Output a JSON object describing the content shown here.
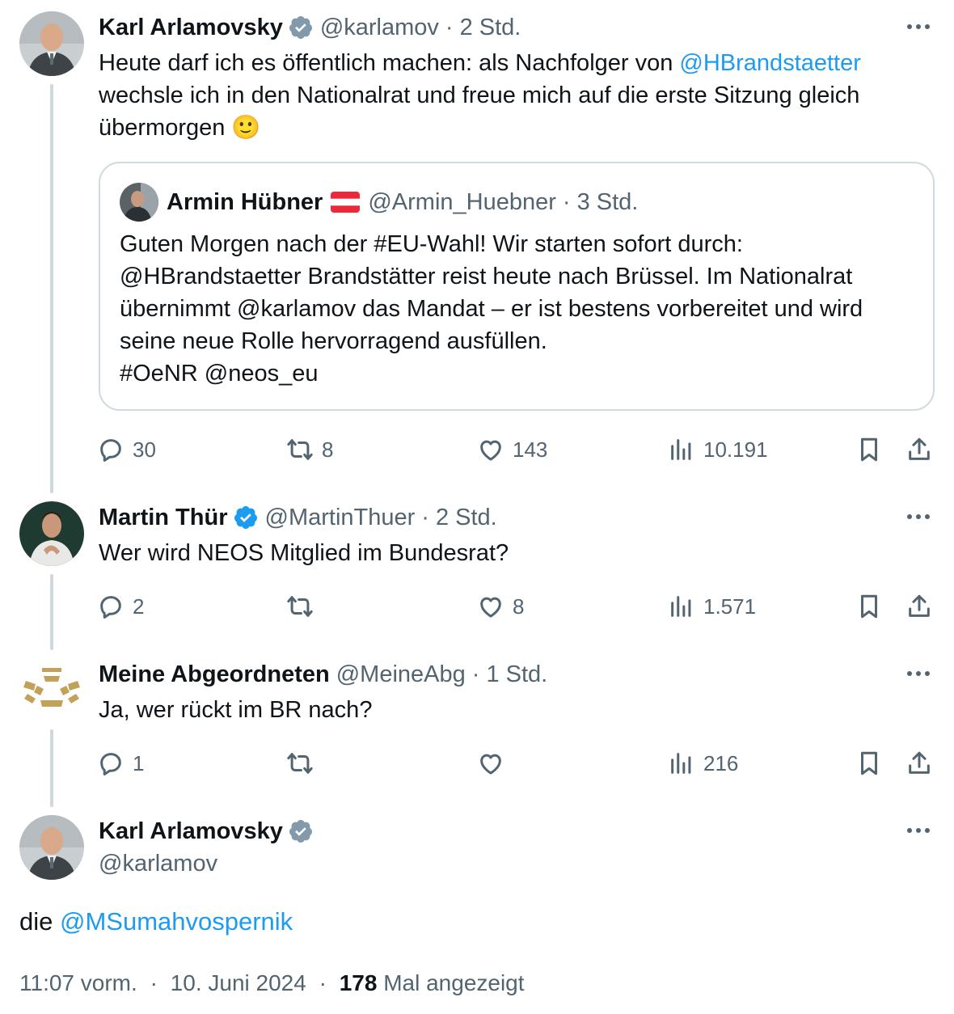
{
  "original": {
    "name": "Karl Arlamovsky",
    "handle": "@karlamov",
    "time": "2 Std.",
    "text_pre": "Heute darf ich es öffentlich machen: als Nachfolger von ",
    "mention": "@HBrandstaetter",
    "text_post": " wechsle ich in den Nationalrat und freue mich auf die erste Sitzung gleich übermorgen 🙂",
    "quote": {
      "name": "Armin Hübner",
      "handle": "@Armin_Huebner",
      "time": "3 Std.",
      "lines": [
        "Guten Morgen nach der #EU-Wahl! Wir starten sofort durch:",
        "@HBrandstaetter Brandstätter reist heute nach Brüssel. Im Nationalrat",
        "übernimmt @karlamov das Mandat – er ist bestens vorbereitet und wird",
        "seine neue Rolle hervorragend ausfüllen.",
        "#OeNR @neos_eu"
      ]
    },
    "stats": {
      "replies": "30",
      "retweets": "8",
      "likes": "143",
      "views": "10.191"
    }
  },
  "reply1": {
    "name": "Martin Thür",
    "handle": "@MartinThuer",
    "time": "2 Std.",
    "text": "Wer wird NEOS Mitglied im Bundesrat?",
    "stats": {
      "replies": "2",
      "retweets": "",
      "likes": "8",
      "views": "1.571"
    }
  },
  "reply2": {
    "name": "Meine Abgeordneten",
    "handle": "@MeineAbg",
    "time": "1 Std.",
    "text": "Ja, wer rückt im BR nach?",
    "stats": {
      "replies": "1",
      "retweets": "",
      "likes": "",
      "views": "216"
    }
  },
  "main": {
    "name": "Karl Arlamovsky",
    "handle": "@karlamov",
    "text_pre": "die ",
    "mention": "@MSumahvospernik",
    "time": "11:07 vorm.",
    "date": "10. Juni 2024",
    "views_count": "178",
    "views_label": "Mal angezeigt"
  },
  "separator": "·",
  "colors": {
    "link": "#1d9bf0",
    "secondary": "#536471",
    "verified": "#1d9bf0",
    "verified_gray": "#829aab",
    "border": "#cfd9de"
  }
}
